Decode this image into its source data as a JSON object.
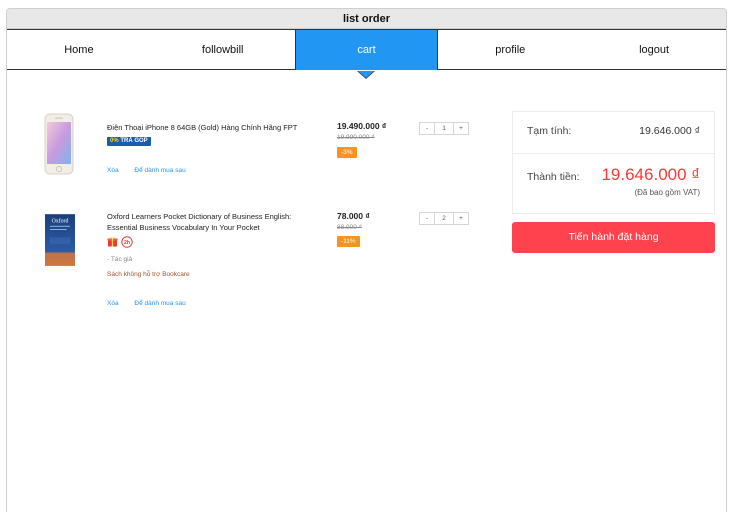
{
  "window": {
    "title": "list order"
  },
  "nav": {
    "items": [
      {
        "label": "Home",
        "active": false
      },
      {
        "label": "followbill",
        "active": false
      },
      {
        "label": "cart",
        "active": true
      },
      {
        "label": "profile",
        "active": false
      },
      {
        "label": "logout",
        "active": false
      }
    ]
  },
  "cart": {
    "items": [
      {
        "name": "Điện Thoại iPhone 8 64GB (Gold)  Hàng Chính Hãng FPT",
        "badge_bold": "0%",
        "badge_text": " TRẢ GÓP",
        "price": "19.490.000 ₫",
        "old_price": "19.990.000 ₫",
        "discount": "-3%",
        "quantity": "1",
        "minus": "-",
        "plus": "+",
        "delete_label": "Xóa",
        "save_later_label": "Để dành mua sau",
        "thumb_icon": "iphone-icon"
      },
      {
        "name": "Oxford Learners Pocket Dictionary of Business English: Essential Business Vocabulary In Your Pocket",
        "gift_badge_text": "2h",
        "author_note": "- Tác giả",
        "bookcare_note": "Sách không hỗ trợ Bookcare",
        "price": "78.000 ₫",
        "old_price": "88.000 ₫",
        "discount": "-11%",
        "quantity": "2",
        "minus": "-",
        "plus": "+",
        "delete_label": "Xóa",
        "save_later_label": "Để dành mua sau",
        "thumb_icon": "book-cover-icon",
        "cover_title": "Oxford"
      }
    ]
  },
  "summary": {
    "subtotal_label": "Tạm tính:",
    "subtotal_value": "19.646.000 ₫",
    "total_label": "Thành tiền:",
    "total_value": "19.646.000 ₫",
    "vat_note": "(Đã bao gồm VAT)",
    "order_button": "Tiến hành đặt hàng"
  },
  "colors": {
    "accent": "#2196f3",
    "order_button": "#ff424e",
    "discount": "#f7941d",
    "total": "#fe3834"
  }
}
